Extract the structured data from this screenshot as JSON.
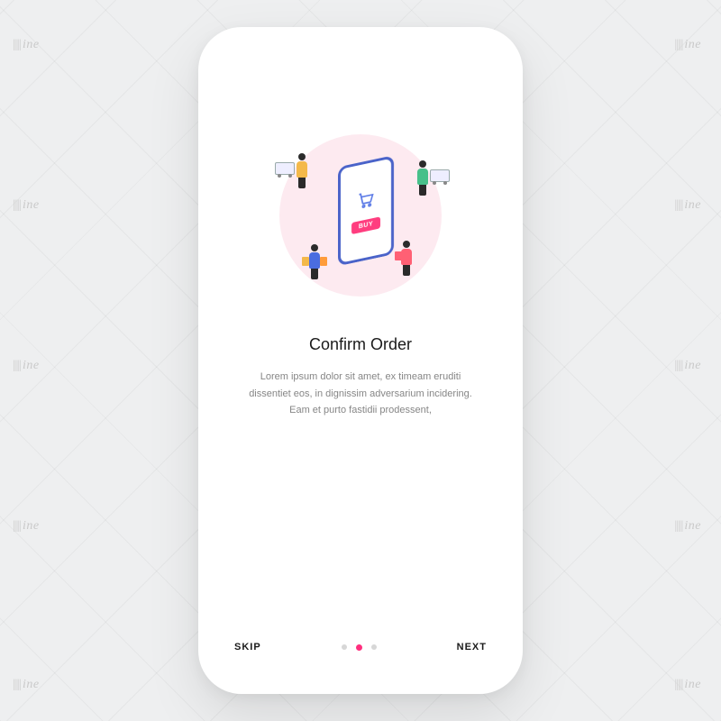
{
  "watermark": "ine",
  "onboarding": {
    "title": "Confirm Order",
    "description": "Lorem ipsum dolor sit amet, ex timeam eruditi dissentiet eos, in dignissim adversarium incidering. Eam et purto fastidii prodessent,",
    "buy_label": "BUY"
  },
  "nav": {
    "skip_label": "SKIP",
    "next_label": "NEXT",
    "page_count": 3,
    "active_index": 1
  },
  "colors": {
    "accent": "#ff2e7e",
    "illus_bg": "#fdeaf0",
    "phone_frame": "#4a63c9"
  }
}
